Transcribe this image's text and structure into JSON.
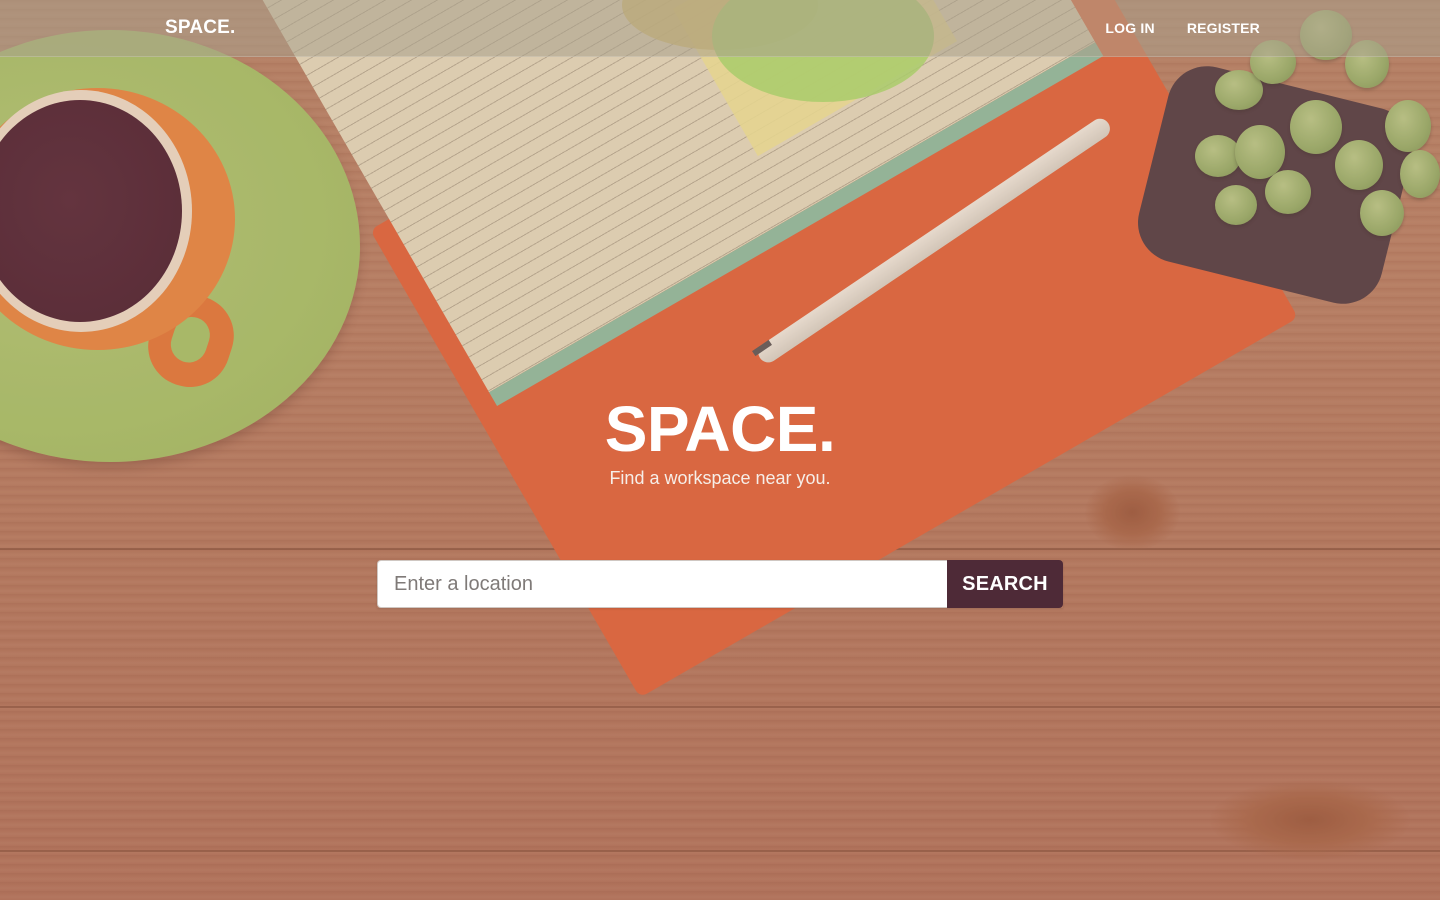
{
  "navbar": {
    "brand": "SPACE.",
    "links": [
      "LOG IN",
      "REGISTER"
    ]
  },
  "hero": {
    "title": "SPACE.",
    "subtitle": "Find a workspace near you."
  },
  "search": {
    "placeholder": "Enter a location",
    "value": "",
    "button_label": "SEARCH"
  },
  "colors": {
    "button_bg": "#4e2a37",
    "navbar_bg": "rgba(170,160,140,0.55)",
    "text": "#ffffff"
  },
  "background": {
    "description_icons": [
      "coffee-cup",
      "notebook",
      "pen",
      "succulent-plant",
      "wood-table"
    ]
  }
}
